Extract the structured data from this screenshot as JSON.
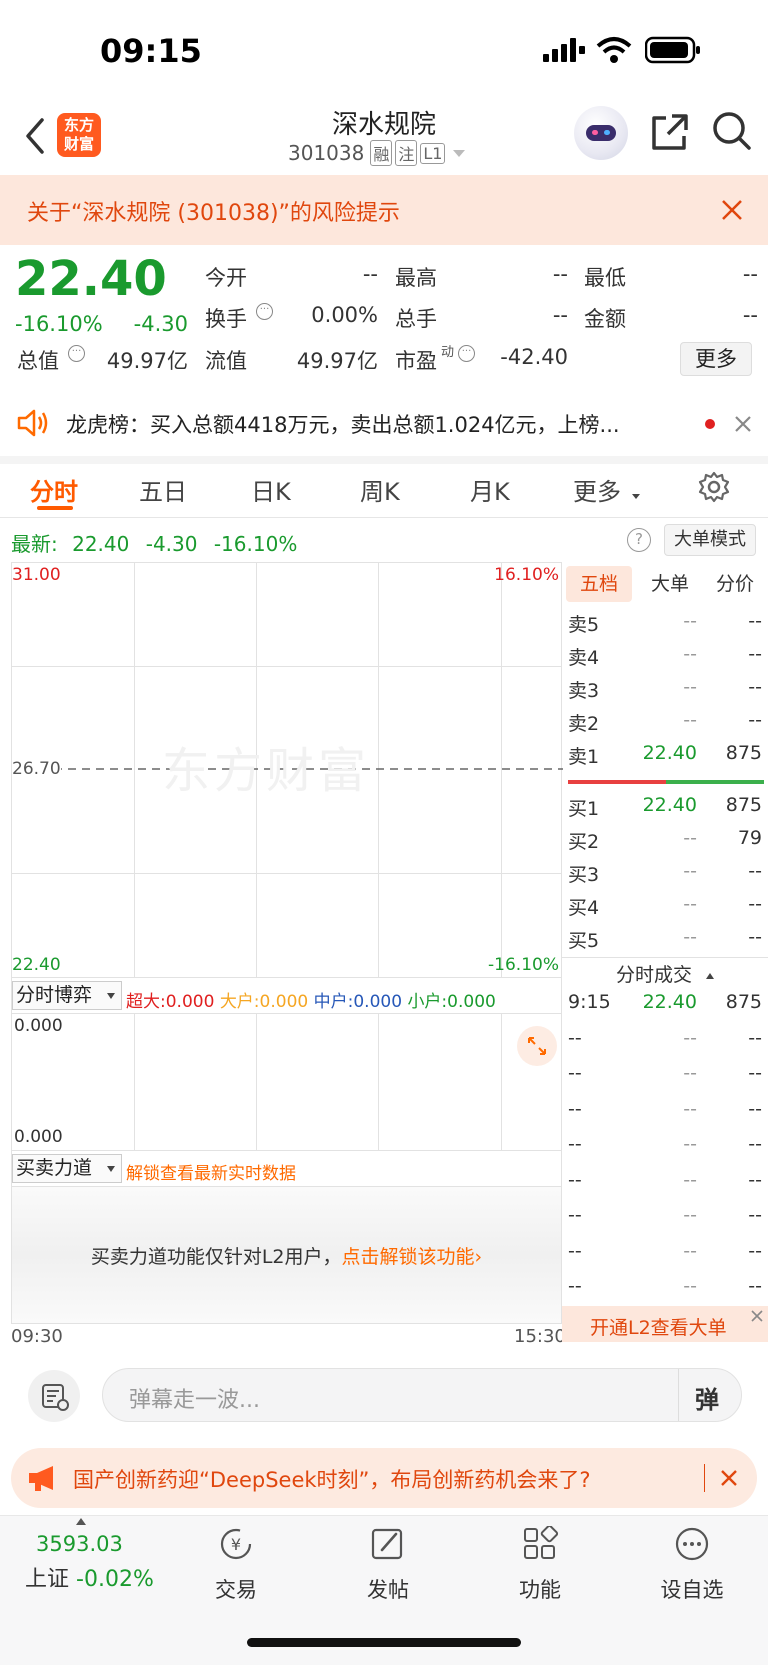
{
  "status": {
    "time": "09:15"
  },
  "header": {
    "logo_line1": "东方",
    "logo_line2": "财富",
    "stock_name": "深水规院",
    "stock_code": "301038",
    "tags": [
      "融",
      "注",
      "L1"
    ]
  },
  "risk_banner": {
    "text": "关于“深水规院 (301038)”的风险提示"
  },
  "quote": {
    "price": "22.40",
    "change_pct": "-16.10%",
    "change": "-4.30",
    "open_label": "今开",
    "open": "--",
    "high_label": "最高",
    "high": "--",
    "low_label": "最低",
    "low": "--",
    "turnover_label": "换手",
    "turnover": "0.00%",
    "volume_label": "总手",
    "volume": "--",
    "amount_label": "金额",
    "amount": "--",
    "mktcap_label": "总值",
    "mktcap": "49.97亿",
    "float_label": "流值",
    "float": "49.97亿",
    "pe_label": "市盈",
    "pe_sup": "动",
    "pe": "-42.40",
    "more_button": "更多"
  },
  "notice": {
    "text": "龙虎榜：买入总额4418万元，卖出总额1.024亿元，上榜..."
  },
  "tabs": [
    "分时",
    "五日",
    "日K",
    "周K",
    "月K",
    "更多"
  ],
  "latest": {
    "label": "最新:",
    "price": "22.40",
    "change": "-4.30",
    "pct": "-16.10%",
    "mode_button": "大单模式"
  },
  "chart": {
    "y_top": "31.00",
    "y_mid": "26.70",
    "y_bottom": "22.40",
    "pct_top": "16.10%",
    "pct_bottom": "-16.10%",
    "watermark": "东方财富",
    "x_start": "09:30",
    "x_end": "15:30"
  },
  "subchart1": {
    "selector": "分时博弈",
    "super_label": "超大:",
    "super": "0.000",
    "big_label": "大户:",
    "big": "0.000",
    "mid_label": "中户:",
    "mid": "0.000",
    "small_label": "小户:",
    "small": "0.000",
    "y_top": "0.000",
    "y_bottom": "0.000"
  },
  "subchart2": {
    "selector": "买卖力道",
    "unlock_hint": "解锁查看最新实时数据",
    "lock_text": "买卖力道功能仅针对L2用户，",
    "lock_link": "点击解锁该功能"
  },
  "orderbook": {
    "tabs": [
      "五档",
      "大单",
      "分价"
    ],
    "asks": [
      {
        "label": "卖5",
        "price": "--",
        "vol": "--"
      },
      {
        "label": "卖4",
        "price": "--",
        "vol": "--"
      },
      {
        "label": "卖3",
        "price": "--",
        "vol": "--"
      },
      {
        "label": "卖2",
        "price": "--",
        "vol": "--"
      },
      {
        "label": "卖1",
        "price": "22.40",
        "vol": "875"
      }
    ],
    "bids": [
      {
        "label": "买1",
        "price": "22.40",
        "vol": "875"
      },
      {
        "label": "买2",
        "price": "--",
        "vol": "79"
      },
      {
        "label": "买3",
        "price": "--",
        "vol": "--"
      },
      {
        "label": "买4",
        "price": "--",
        "vol": "--"
      },
      {
        "label": "买5",
        "price": "--",
        "vol": "--"
      }
    ],
    "trades_title": "分时成交",
    "trades": [
      {
        "time": "9:15",
        "price": "22.40",
        "vol": "875"
      },
      {
        "time": "--",
        "price": "--",
        "vol": "--"
      },
      {
        "time": "--",
        "price": "--",
        "vol": "--"
      },
      {
        "time": "--",
        "price": "--",
        "vol": "--"
      },
      {
        "time": "--",
        "price": "--",
        "vol": "--"
      },
      {
        "time": "--",
        "price": "--",
        "vol": "--"
      },
      {
        "time": "--",
        "price": "--",
        "vol": "--"
      },
      {
        "time": "--",
        "price": "--",
        "vol": "--"
      },
      {
        "time": "--",
        "price": "--",
        "vol": "--"
      }
    ],
    "l2_banner": "开通L2查看大单"
  },
  "comment": {
    "placeholder": "弹幕走一波...",
    "send_label": "弹"
  },
  "promo": {
    "text": "国产创新药迎“DeepSeek时刻”，布局创新药机会来了?"
  },
  "bottom_nav": {
    "index_value": "3593.03",
    "index_name": "上证",
    "index_change": "-0.02%",
    "items": [
      "交易",
      "发帖",
      "功能",
      "设自选"
    ]
  }
}
